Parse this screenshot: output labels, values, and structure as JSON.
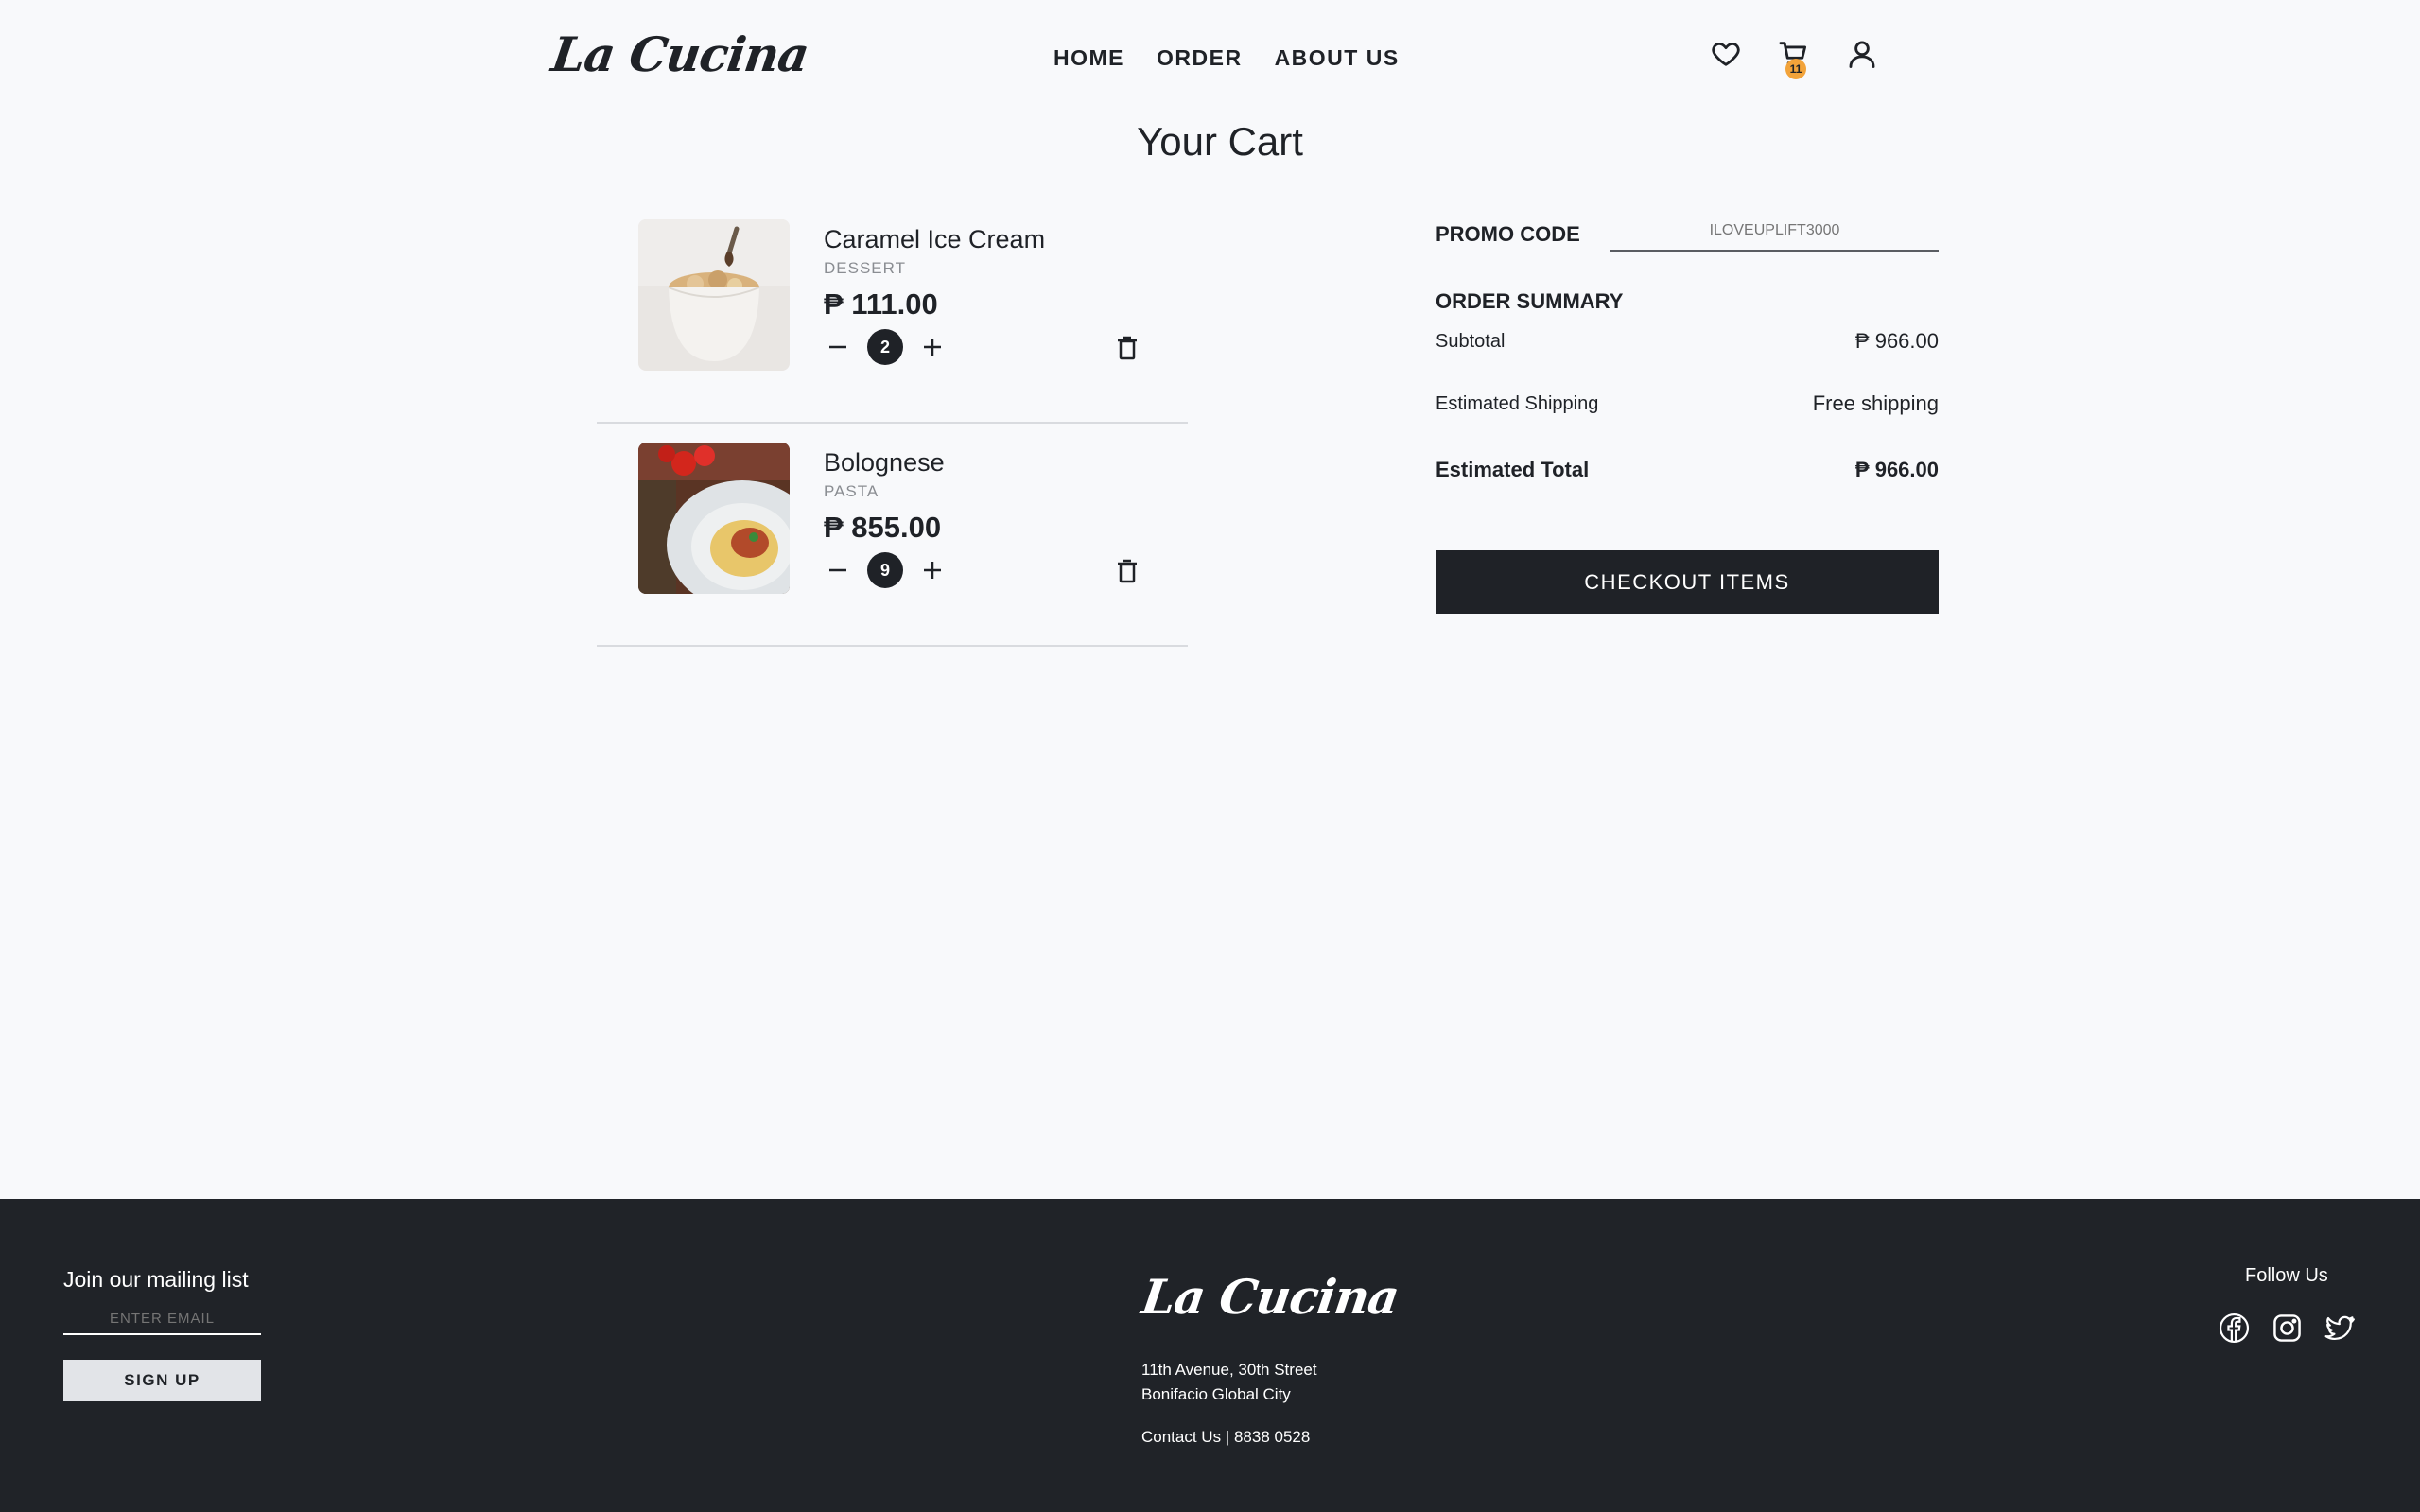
{
  "header": {
    "logo": "La Cucina",
    "nav": [
      "HOME",
      "ORDER",
      "ABOUT US"
    ],
    "cart_count": "11",
    "icons": [
      "heart-icon",
      "cart-icon",
      "user-icon"
    ]
  },
  "page_title": "Your Cart",
  "cart": {
    "items": [
      {
        "name": "Caramel Ice Cream",
        "category": "DESSERT",
        "price": "₱ 111.00",
        "quantity": "2"
      },
      {
        "name": "Bolognese",
        "category": "PASTA",
        "price": "₱ 855.00",
        "quantity": "9"
      }
    ]
  },
  "summary": {
    "promo_label": "PROMO CODE",
    "promo_placeholder": "ILOVEUPLIFT3000",
    "title": "ORDER SUMMARY",
    "subtotal_label": "Subtotal",
    "subtotal_value": "₱ 966.00",
    "shipping_label": "Estimated Shipping",
    "shipping_value": "Free shipping",
    "total_label": "Estimated Total",
    "total_value": "₱ 966.00",
    "checkout_label": "CHECKOUT ITEMS"
  },
  "footer": {
    "mailing_title": "Join our mailing list",
    "email_placeholder": "ENTER EMAIL",
    "signup_label": "SIGN UP",
    "logo": "La Cucina",
    "address_line1": "11th Avenue, 30th Street",
    "address_line2": "Bonifacio Global City",
    "contact": "Contact Us | 8838 0528",
    "follow_label": "Follow Us",
    "socials": [
      "facebook-icon",
      "instagram-icon",
      "twitter-icon"
    ]
  },
  "colors": {
    "dark": "#1f2227",
    "accent": "#f2a33a",
    "background": "#f8f9fb"
  }
}
